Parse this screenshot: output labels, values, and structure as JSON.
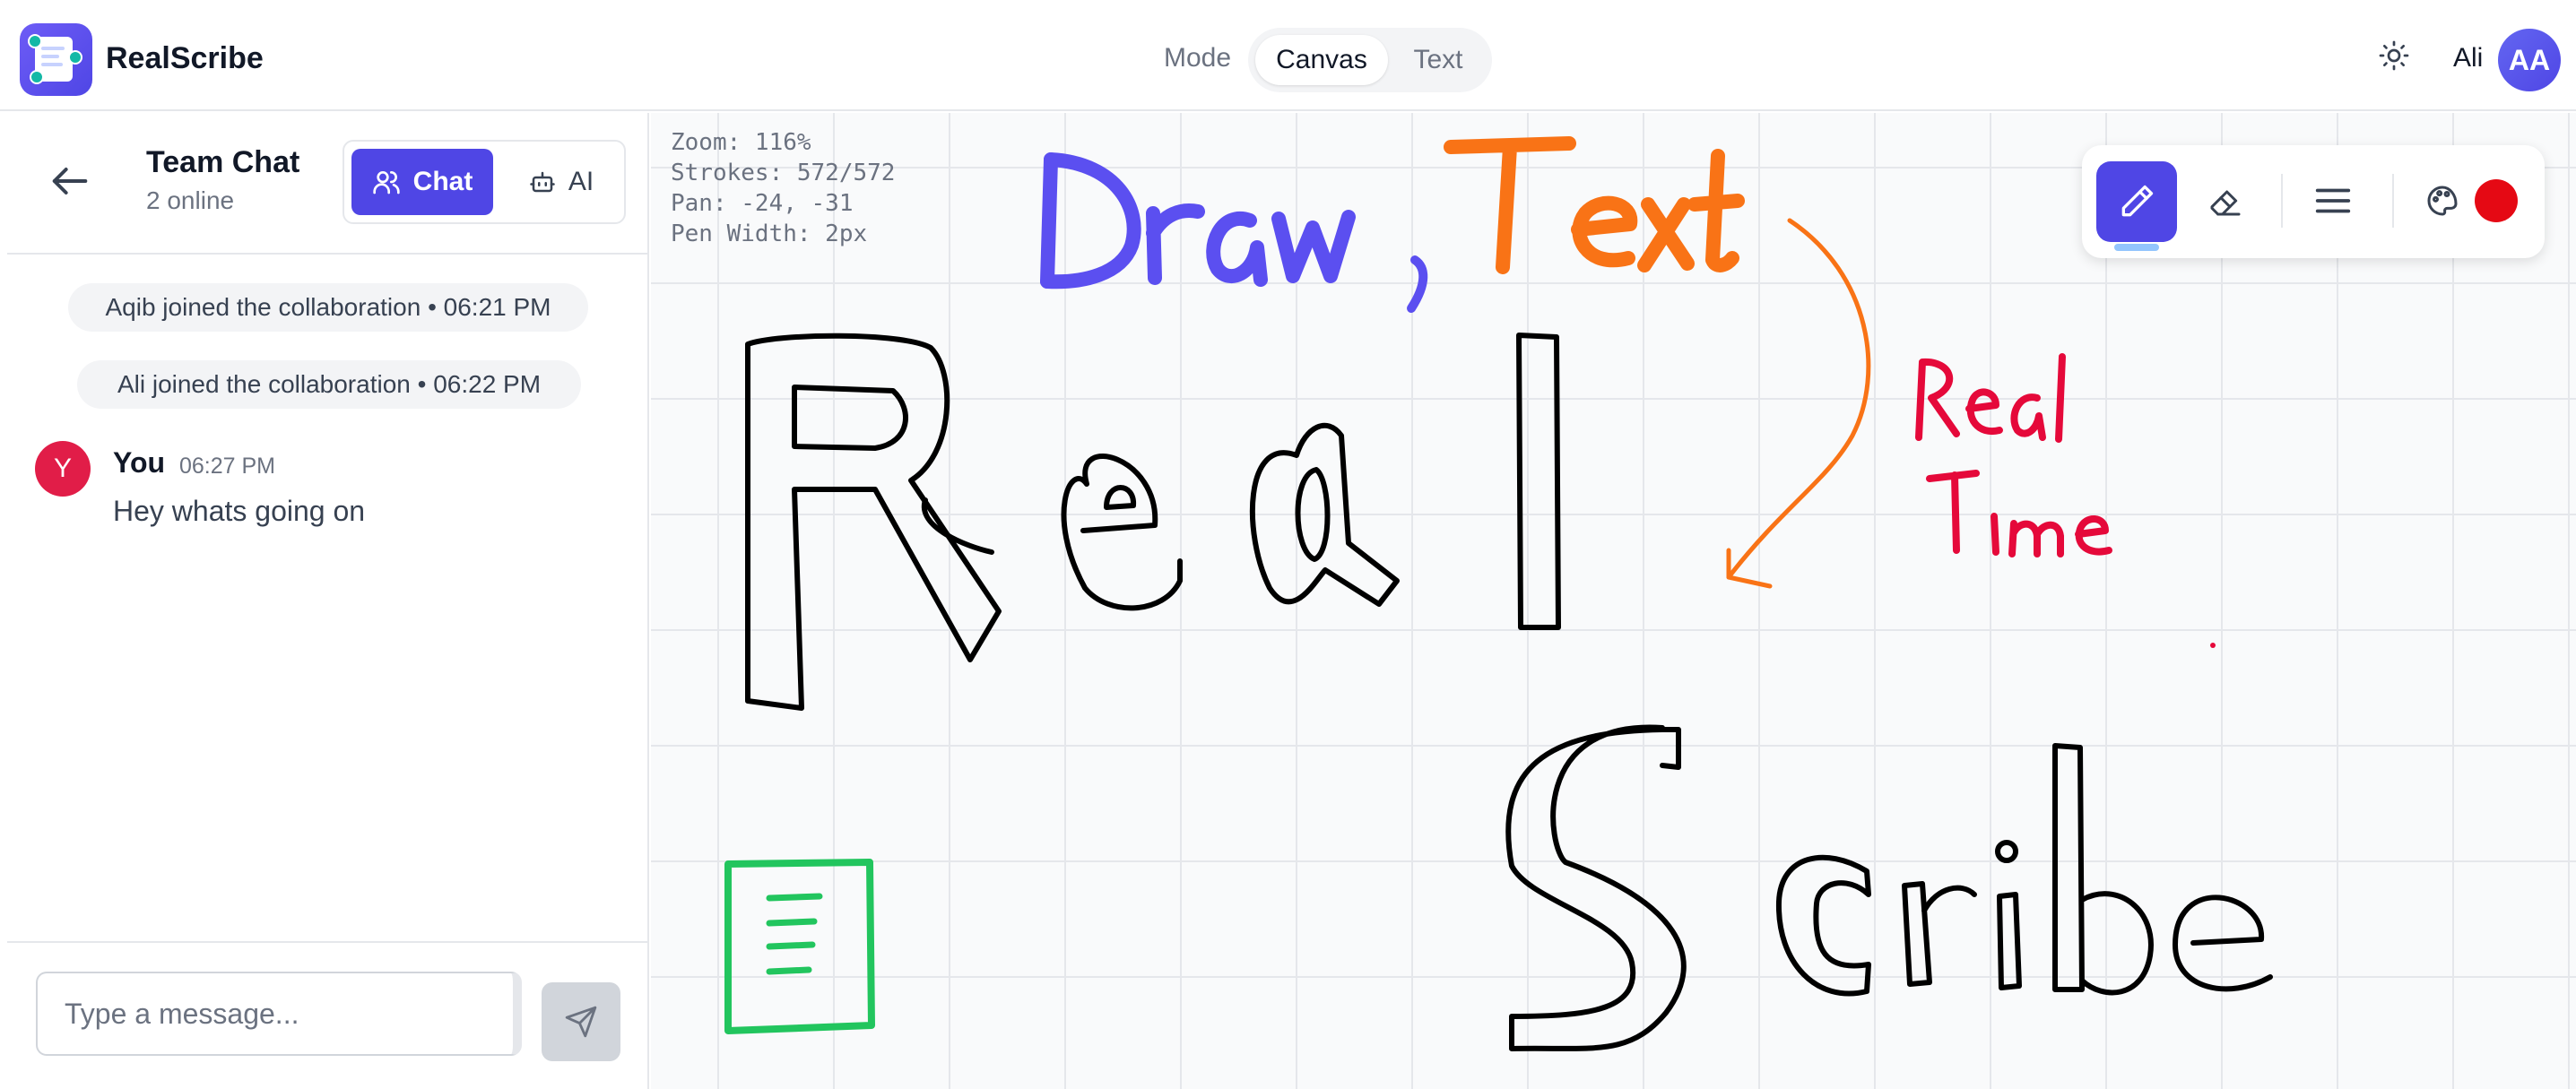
{
  "app": {
    "title": "RealScribe"
  },
  "header": {
    "mode_label": "Mode",
    "modes": [
      "Canvas",
      "Text"
    ],
    "active_mode": "Canvas",
    "theme_icon": "sun-icon",
    "user_name": "Ali",
    "user_initials": "AA"
  },
  "sidebar": {
    "title": "Team Chat",
    "subtitle": "2 online",
    "tabs": [
      {
        "label": "Chat",
        "icon": "users-icon",
        "active": true
      },
      {
        "label": "AI",
        "icon": "bot-icon",
        "active": false
      }
    ],
    "system_messages": [
      "Aqib joined the collaboration • 06:21 PM",
      "Ali joined the collaboration • 06:22 PM"
    ],
    "messages": [
      {
        "avatar_initial": "Y",
        "author": "You",
        "time": "06:27 PM",
        "text": "Hey whats going on"
      }
    ],
    "input_placeholder": "Type a message...",
    "input_value": ""
  },
  "canvas": {
    "stats": {
      "zoom": "Zoom: 116%",
      "strokes": "Strokes: 572/572",
      "pan": "Pan: -24, -31",
      "pen_width": "Pen Width: 2px"
    }
  },
  "toolbar": {
    "tools": [
      "pen-icon",
      "eraser-icon",
      "stroke-width-icon",
      "palette-icon"
    ],
    "active_tool": "pen",
    "selected_color": "#e50914"
  },
  "colors": {
    "accent": "#4f46e5",
    "draw_blue": "#5b4ff0",
    "draw_orange": "#f97316",
    "draw_red": "#e5093a",
    "draw_green": "#22c55e",
    "avatar_red": "#e11d48"
  }
}
